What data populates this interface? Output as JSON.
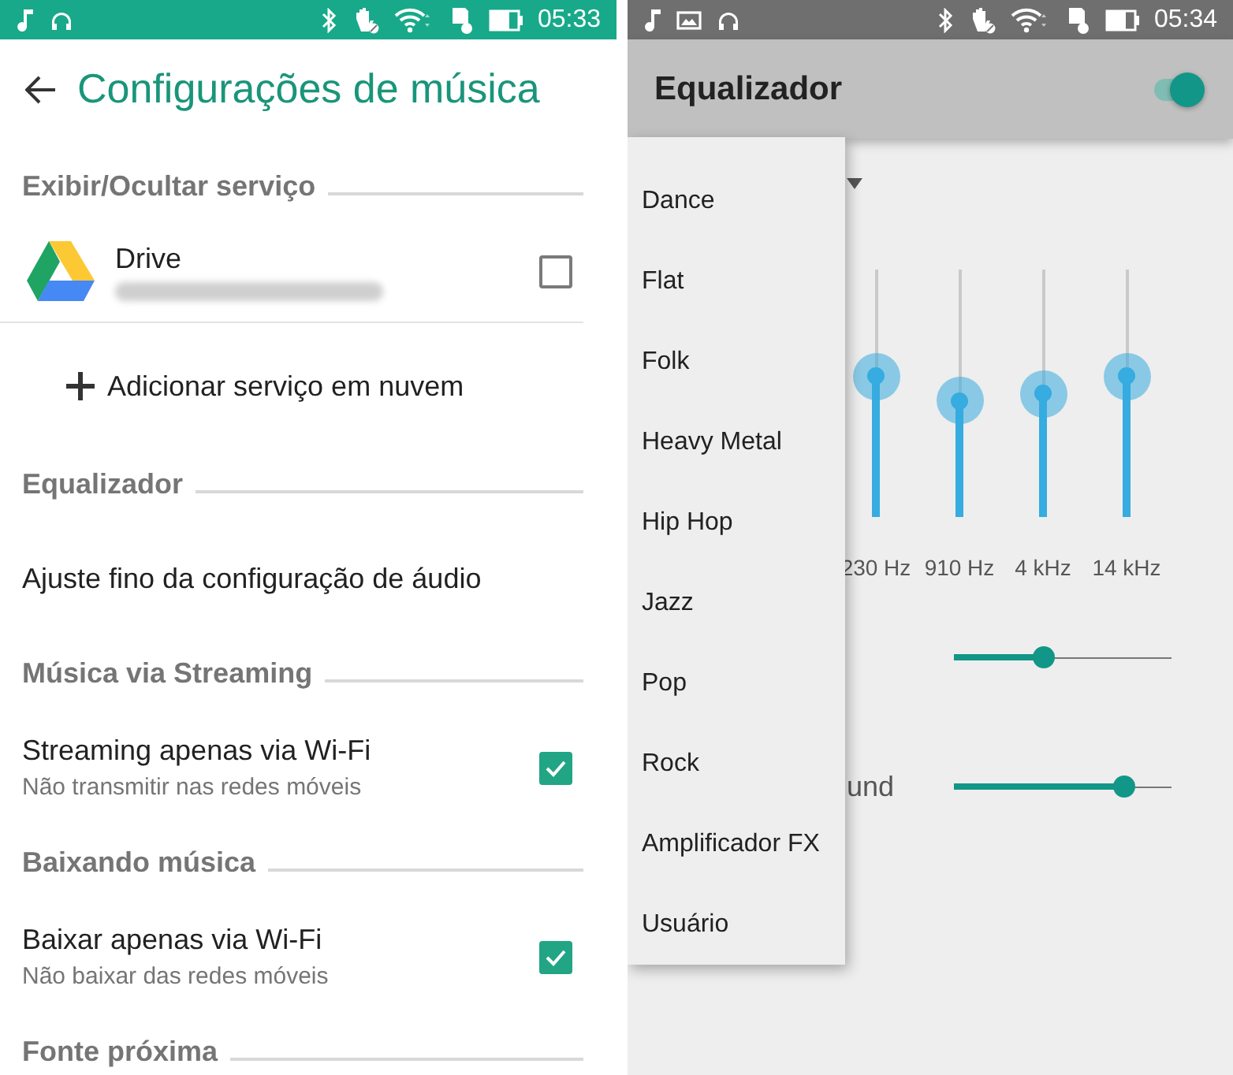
{
  "left_screen": {
    "status_bar": {
      "time": "05:33"
    },
    "title": "Configurações de música",
    "sections": [
      {
        "header": "Exibir/Ocultar serviço",
        "items": [
          {
            "kind": "account",
            "title": "Drive",
            "checked": false
          },
          {
            "kind": "action",
            "title": "Adicionar serviço em nuvem"
          }
        ]
      },
      {
        "header": "Equalizador",
        "items": [
          {
            "kind": "link",
            "title": "Ajuste fino da configuração de áudio"
          }
        ]
      },
      {
        "header": "Música via Streaming",
        "items": [
          {
            "kind": "check",
            "title": "Streaming apenas via Wi-Fi",
            "subtitle": "Não transmitir nas redes móveis",
            "checked": true
          }
        ]
      },
      {
        "header": "Baixando música",
        "items": [
          {
            "kind": "check",
            "title": "Baixar apenas via Wi-Fi",
            "subtitle": "Não baixar das redes móveis",
            "checked": true
          }
        ]
      },
      {
        "header": "Fonte próxima"
      }
    ]
  },
  "right_screen": {
    "status_bar": {
      "time": "05:34"
    },
    "title": "Equalizador",
    "on": true,
    "bands": [
      {
        "label": "230 Hz",
        "level": 0.57
      },
      {
        "label": "910 Hz",
        "level": 0.47
      },
      {
        "label": "4 kHz",
        "level": 0.5
      },
      {
        "label": "14 kHz",
        "level": 0.57
      }
    ],
    "sliders": [
      {
        "level": 0.41
      },
      {
        "label": "und",
        "level": 0.78
      }
    ],
    "preset_menu": {
      "items": [
        {
          "label": "Dance"
        },
        {
          "label": "Flat"
        },
        {
          "label": "Folk"
        },
        {
          "label": "Heavy Metal"
        },
        {
          "label": "Hip Hop"
        },
        {
          "label": "Jazz"
        },
        {
          "label": "Pop"
        },
        {
          "label": "Rock"
        },
        {
          "label": "Amplificador FX"
        },
        {
          "label": "Usuário"
        }
      ]
    }
  }
}
